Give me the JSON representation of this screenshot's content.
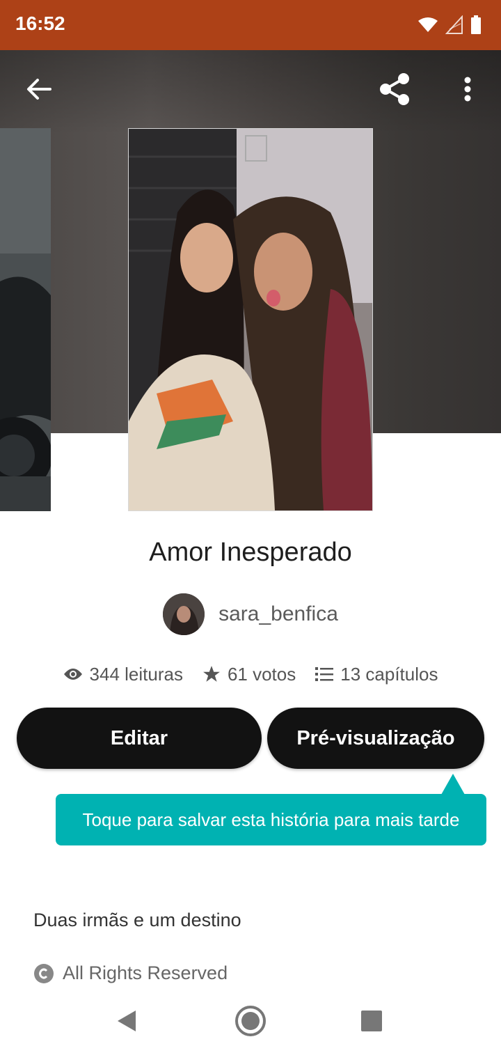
{
  "status_bar": {
    "time": "16:52",
    "color": "#ad4117",
    "icons": [
      "wifi-icon",
      "cell-signal-icon",
      "battery-icon"
    ]
  },
  "toolbar": {
    "back_icon": "arrow-left-icon",
    "share_icon": "share-icon",
    "more_icon": "more-vertical-icon"
  },
  "story": {
    "title": "Amor Inesperado",
    "author": "sara_benfica",
    "stats": {
      "reads": "344 leituras",
      "votes": "61 votos",
      "chapters": "13 capítulos"
    },
    "description": "Duas irmãs e um destino",
    "copyright": "All Rights Reserved"
  },
  "actions": {
    "edit_label": "Editar",
    "preview_label": "Pré-visualização"
  },
  "tooltip": {
    "text": "Toque para salvar esta história para mais tarde",
    "color": "#00b2b2"
  },
  "nav": {
    "icons": [
      "back-triangle-icon",
      "home-circle-icon",
      "recents-square-icon"
    ]
  }
}
